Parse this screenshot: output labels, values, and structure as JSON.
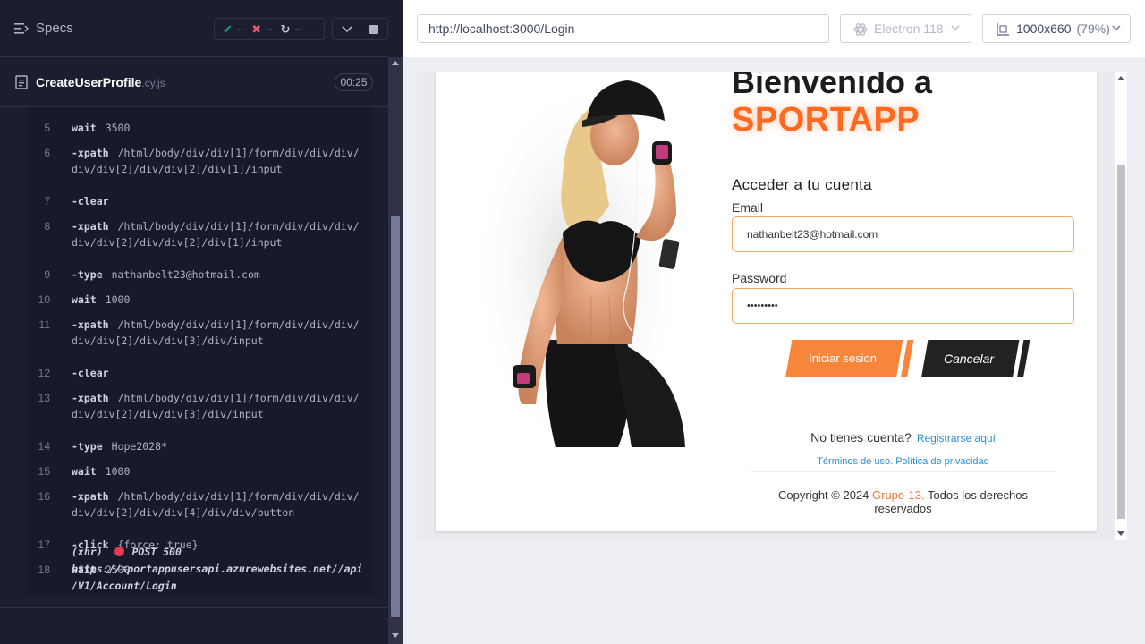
{
  "reporter": {
    "specs_label": "Specs",
    "stats": {
      "passed": "--",
      "failed": "--",
      "pending": "--"
    },
    "spec_file": {
      "name": "CreateUserProfile",
      "ext": ".cy.js",
      "duration": "00:25"
    },
    "commands": [
      {
        "num": "5",
        "name": "wait",
        "message": "3500"
      },
      {
        "num": "6",
        "name": "-xpath",
        "message": "/html/body/div/div[1]/form/div/div/div/",
        "message2": "div/div[2]/div/div[2]/div[1]/input"
      },
      {
        "num": "7",
        "name": "-clear",
        "message": ""
      },
      {
        "num": "8",
        "name": "-xpath",
        "message": "/html/body/div/div[1]/form/div/div/div/",
        "message2": "div/div[2]/div/div[2]/div[1]/input"
      },
      {
        "num": "9",
        "name": "-type",
        "message": "nathanbelt23@hotmail.com"
      },
      {
        "num": "10",
        "name": "wait",
        "message": "1000"
      },
      {
        "num": "11",
        "name": "-xpath",
        "message": "/html/body/div/div[1]/form/div/div/div/",
        "message2": "div/div[2]/div/div[3]/div/input"
      },
      {
        "num": "12",
        "name": "-clear",
        "message": ""
      },
      {
        "num": "13",
        "name": "-xpath",
        "message": "/html/body/div/div[1]/form/div/div/div/",
        "message2": "div/div[2]/div/div[3]/div/input"
      },
      {
        "num": "14",
        "name": "-type",
        "message": "Hope2028*"
      },
      {
        "num": "15",
        "name": "wait",
        "message": "1000"
      },
      {
        "num": "16",
        "name": "-xpath",
        "message": "/html/body/div/div[1]/form/div/div/div/",
        "message2": "div/div[2]/div/div[4]/div/div/button"
      },
      {
        "num": "17",
        "name": "-click",
        "message": "{force: true}"
      },
      {
        "num": "18",
        "name": "wait",
        "message": "2500"
      }
    ],
    "xhr": {
      "label": "(xhr)",
      "method_status": "POST 500",
      "url_line1": "https://sportappusersapi.azurewebsites.net//api",
      "url_line2": "/V1/Account/Login"
    }
  },
  "browser_bar": {
    "url": "http://localhost:3000/Login",
    "browser": "Electron 118",
    "viewport": "1000x660",
    "zoom": "(79%)"
  },
  "app": {
    "welcome": "Bienvenido a",
    "brand": "SPORTAPP",
    "access_title": "Acceder a tu cuenta",
    "email_label": "Email",
    "email_value": "nathanbelt23@hotmail.com",
    "password_label": "Password",
    "password_value": "•••••••••",
    "login_button": "Iniciar sesion",
    "cancel_button": "Cancelar",
    "no_account": "No tienes cuenta?",
    "register_link": "Registrarse aquí",
    "terms": "Términos de uso. Política de privacidad",
    "copyright_prefix": "Copyright © 2024",
    "copyright_group": "Grupo-13.",
    "copyright_suffix": "Todos los derechos reservados"
  },
  "colors": {
    "brand_orange": "#ff6a22",
    "button_orange": "#f7853a",
    "cancel_black": "#222222",
    "link_blue": "#2a8fd4",
    "reporter_bg": "#1b1e2e",
    "pass_green": "#1fa971",
    "fail_red": "#e45770",
    "xhr_dot": "#e23c52"
  },
  "icons": {
    "menu": "menu-icon",
    "pass": "check-icon",
    "fail": "x-icon",
    "pending": "spinner-icon",
    "chevron": "chevron-down-icon",
    "stop": "stop-icon",
    "file": "document-icon",
    "browser": "electron-icon",
    "viewport": "ruler-icon"
  }
}
